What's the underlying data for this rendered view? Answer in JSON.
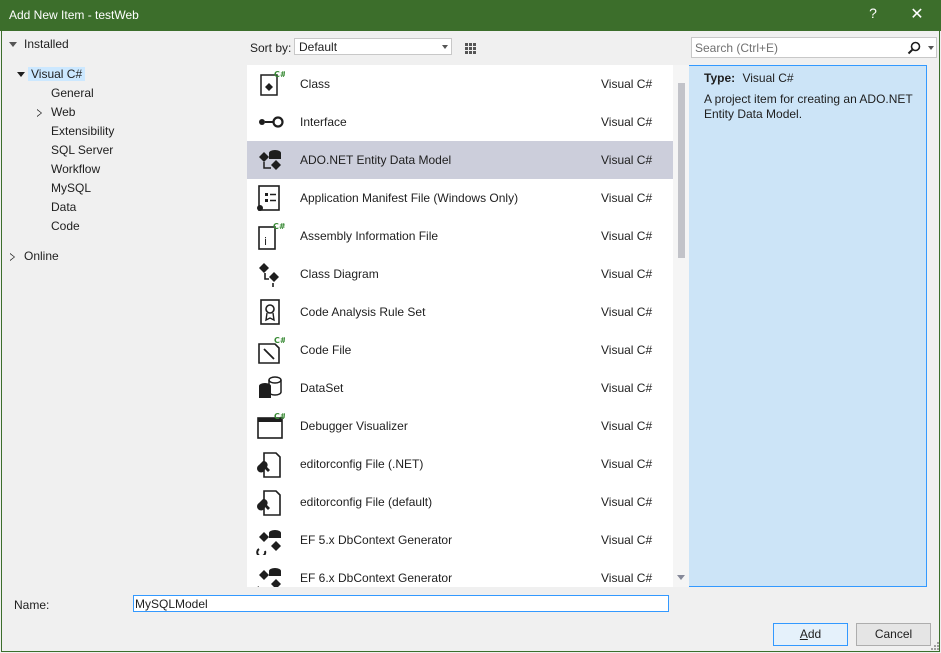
{
  "window": {
    "title": "Add New Item - testWeb",
    "help_glyph": "?",
    "close_glyph": "✕"
  },
  "tree": {
    "installed": "Installed",
    "visual_csharp": "Visual C#",
    "children": [
      "General",
      "Web",
      "Extensibility",
      "SQL Server",
      "Workflow",
      "MySQL",
      "Data",
      "Code"
    ],
    "online": "Online"
  },
  "sort": {
    "label": "Sort by:",
    "value": "Default"
  },
  "search": {
    "placeholder": "Search (Ctrl+E)"
  },
  "items": [
    {
      "name": "Class",
      "lang": "Visual C#",
      "icon": "class-icon"
    },
    {
      "name": "Interface",
      "lang": "Visual C#",
      "icon": "interface-icon"
    },
    {
      "name": "ADO.NET Entity Data Model",
      "lang": "Visual C#",
      "icon": "entity-model-icon"
    },
    {
      "name": "Application Manifest File (Windows Only)",
      "lang": "Visual C#",
      "icon": "manifest-icon"
    },
    {
      "name": "Assembly Information File",
      "lang": "Visual C#",
      "icon": "assembly-info-icon"
    },
    {
      "name": "Class Diagram",
      "lang": "Visual C#",
      "icon": "class-diagram-icon"
    },
    {
      "name": "Code Analysis Rule Set",
      "lang": "Visual C#",
      "icon": "rule-set-icon"
    },
    {
      "name": "Code File",
      "lang": "Visual C#",
      "icon": "code-file-icon"
    },
    {
      "name": "DataSet",
      "lang": "Visual C#",
      "icon": "dataset-icon"
    },
    {
      "name": "Debugger Visualizer",
      "lang": "Visual C#",
      "icon": "debugger-visualizer-icon"
    },
    {
      "name": "editorconfig File (.NET)",
      "lang": "Visual C#",
      "icon": "editorconfig-icon"
    },
    {
      "name": "editorconfig File (default)",
      "lang": "Visual C#",
      "icon": "editorconfig-icon"
    },
    {
      "name": "EF 5.x DbContext Generator",
      "lang": "Visual C#",
      "icon": "ef-generator-icon"
    },
    {
      "name": "EF 6.x DbContext Generator",
      "lang": "Visual C#",
      "icon": "ef-generator-icon"
    }
  ],
  "selected_index": 2,
  "description": {
    "type_label": "Type:",
    "type_value": "Visual C#",
    "text": "A project item for creating an ADO.NET Entity Data Model."
  },
  "name_field": {
    "label": "Name:",
    "value": "MySQLModel"
  },
  "buttons": {
    "add_prefix": "",
    "add_underlined": "A",
    "add_rest": "dd",
    "cancel": "Cancel"
  },
  "colors": {
    "title_bar": "#3c6e2b",
    "selection": "#cccedb",
    "tree_selection": "#cce8ff",
    "accent": "#3399ff"
  }
}
